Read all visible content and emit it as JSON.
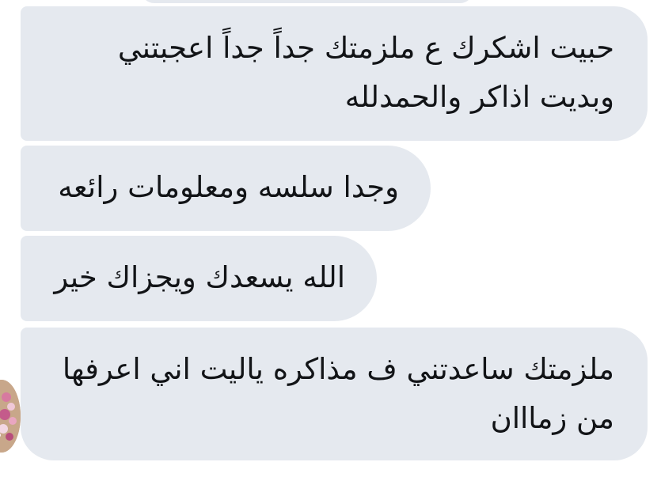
{
  "conversation": {
    "messages": [
      {
        "lines": [
          "حبيت اشكرك ع ملزمتك جداً جداً اعجبتني",
          "وبديت اذاكر والحمدلله"
        ]
      },
      {
        "lines": [
          "وجدا سلسه ومعلومات رائعه"
        ]
      },
      {
        "lines": [
          "الله يسعدك ويجزاك خير"
        ]
      },
      {
        "lines": [
          "ملزمتك ساعدتني ف مذاكره ياليت اني اعرفها",
          "من زمااان"
        ]
      }
    ]
  },
  "colors": {
    "bubble_background": "#e5e9ef",
    "message_text": "#121417",
    "page_background": "#ffffff"
  },
  "icons": {
    "sender_avatar": "flower-avatar-icon"
  }
}
